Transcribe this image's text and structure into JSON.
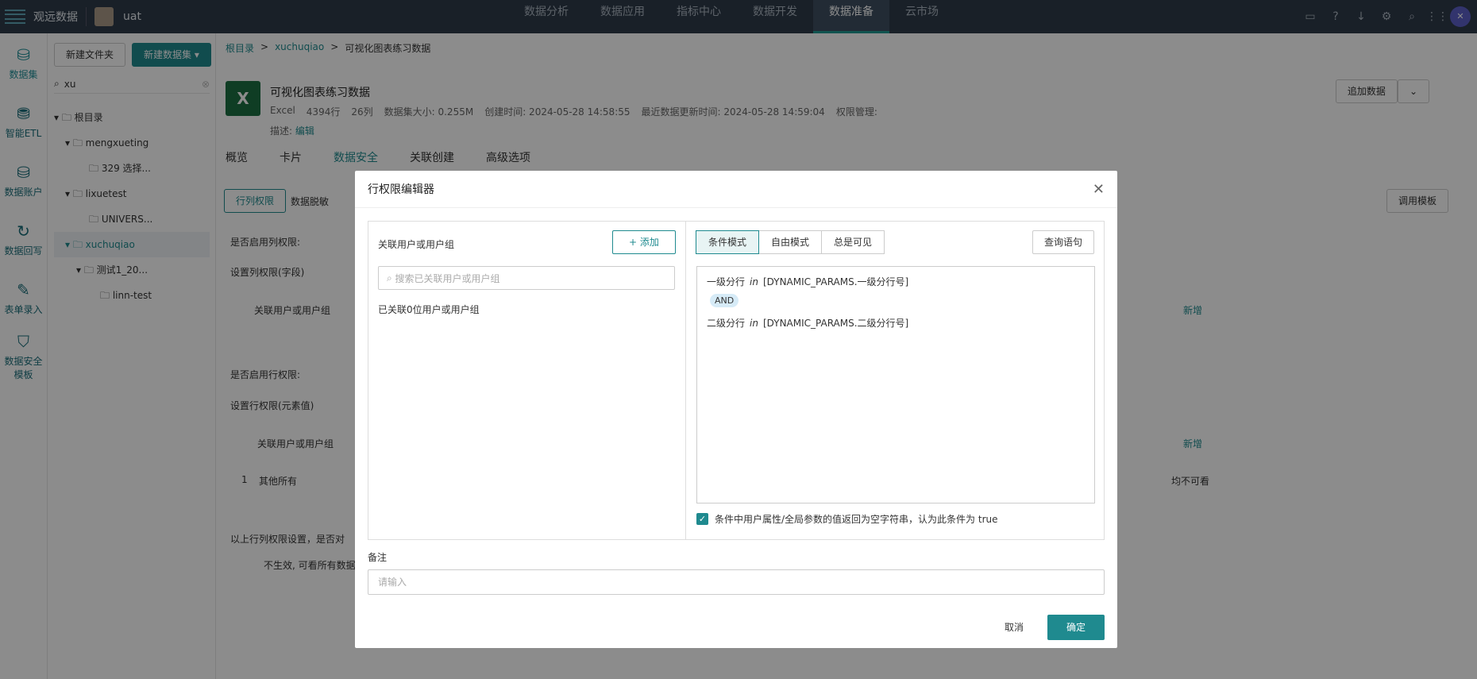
{
  "topbar": {
    "brand": "观远数据",
    "workspace": "uat",
    "nav": [
      "数据分析",
      "数据应用",
      "指标中心",
      "数据开发",
      "数据准备",
      "云市场"
    ],
    "active_nav": "数据准备"
  },
  "leftnav": [
    "数据集",
    "智能ETL",
    "数据账户",
    "数据回写",
    "表单录入",
    "数据安全模板"
  ],
  "tree": {
    "new_folder": "新建文件夹",
    "new_dataset": "新建数据集",
    "search_value": "xu",
    "nodes": [
      "根目录",
      "mengxueting",
      "329 选择...",
      "lixuetest",
      "UNIVERS...",
      "xuchuqiao",
      "测试1_20...",
      "linn-test"
    ]
  },
  "breadcrumb": [
    "根目录",
    "xuchuqiao",
    "可视化图表练习数据"
  ],
  "dataset": {
    "title": "可视化图表练习数据",
    "type": "Excel",
    "rows": "4394行",
    "cols": "26列",
    "size": "数据集大小: 0.255M",
    "created": "创建时间: 2024-05-28 14:58:55",
    "updated": "最近数据更新时间: 2024-05-28 14:59:04",
    "perm": "权限管理:",
    "desc_label": "描述:",
    "edit": "编辑"
  },
  "actions": {
    "append": "追加数据",
    "template": "调用模板"
  },
  "tabs": [
    "概览",
    "卡片",
    "数据安全",
    "关联创建",
    "高级选项"
  ],
  "bg": {
    "subtab1": "行列权限",
    "subtab2": "数据脱敏",
    "col_perm": "是否启用列权限:",
    "col_set": "设置列权限(字段)",
    "assoc": "关联用户或用户组",
    "add": "新增",
    "row_perm": "是否启用行权限:",
    "row_set": "设置行权限(元素值)",
    "row1_no": "1",
    "row1": "其他所有",
    "row1_val": "均不可看",
    "bottom": "以上行列权限设置，是否对",
    "toggle_txt": "不生效, 可看所有数据"
  },
  "modal": {
    "title": "行权限编辑器",
    "left_header": "关联用户或用户组",
    "add": "添加",
    "search_placeholder": "搜索已关联用户或用户组",
    "count_text": "已关联0位用户或用户组",
    "modes": [
      "条件模式",
      "自由模式",
      "总是可见"
    ],
    "query": "查询语句",
    "cond1_field": "一级分行",
    "cond_op": "in",
    "cond1_val": "[DYNAMIC_PARAMS.一级分行号]",
    "and": "AND",
    "cond2_field": "二级分行",
    "cond2_val": "[DYNAMIC_PARAMS.二级分行号]",
    "checkbox": "条件中用户属性/全局参数的值返回为空字符串，认为此条件为 true",
    "remark_label": "备注",
    "remark_placeholder": "请输入",
    "cancel": "取消",
    "ok": "确定"
  }
}
